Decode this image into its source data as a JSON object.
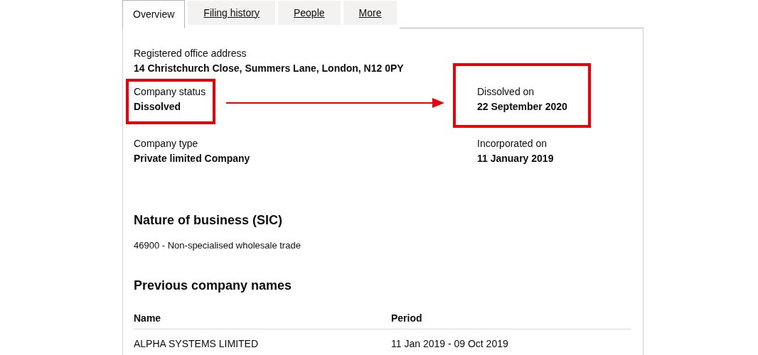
{
  "tabs": [
    {
      "label": "Overview",
      "selected": true
    },
    {
      "label": "Filing history",
      "selected": false
    },
    {
      "label": "People",
      "selected": false
    },
    {
      "label": "More",
      "selected": false
    }
  ],
  "address": {
    "label": "Registered office address",
    "value": "14 Christchurch Close, Summers Lane, London, N12 0PY"
  },
  "fields": [
    {
      "label": "Company status",
      "value": "Dissolved",
      "highlighted": true
    },
    {
      "label": "Dissolved on",
      "value": "22 September 2020",
      "highlighted": true
    },
    {
      "label": "Company type",
      "value": "Private limited Company",
      "highlighted": false
    },
    {
      "label": "Incorporated on",
      "value": "11 January 2019",
      "highlighted": false
    }
  ],
  "nature_of_business": {
    "heading": "Nature of business (SIC)",
    "items": [
      "46900 - Non-specialised wholesale trade"
    ]
  },
  "previous_names": {
    "heading": "Previous company names",
    "columns": [
      "Name",
      "Period"
    ],
    "rows": [
      [
        "ALPHA SYSTEMS LIMITED",
        "11 Jan 2019 - 09 Oct 2019"
      ]
    ]
  }
}
